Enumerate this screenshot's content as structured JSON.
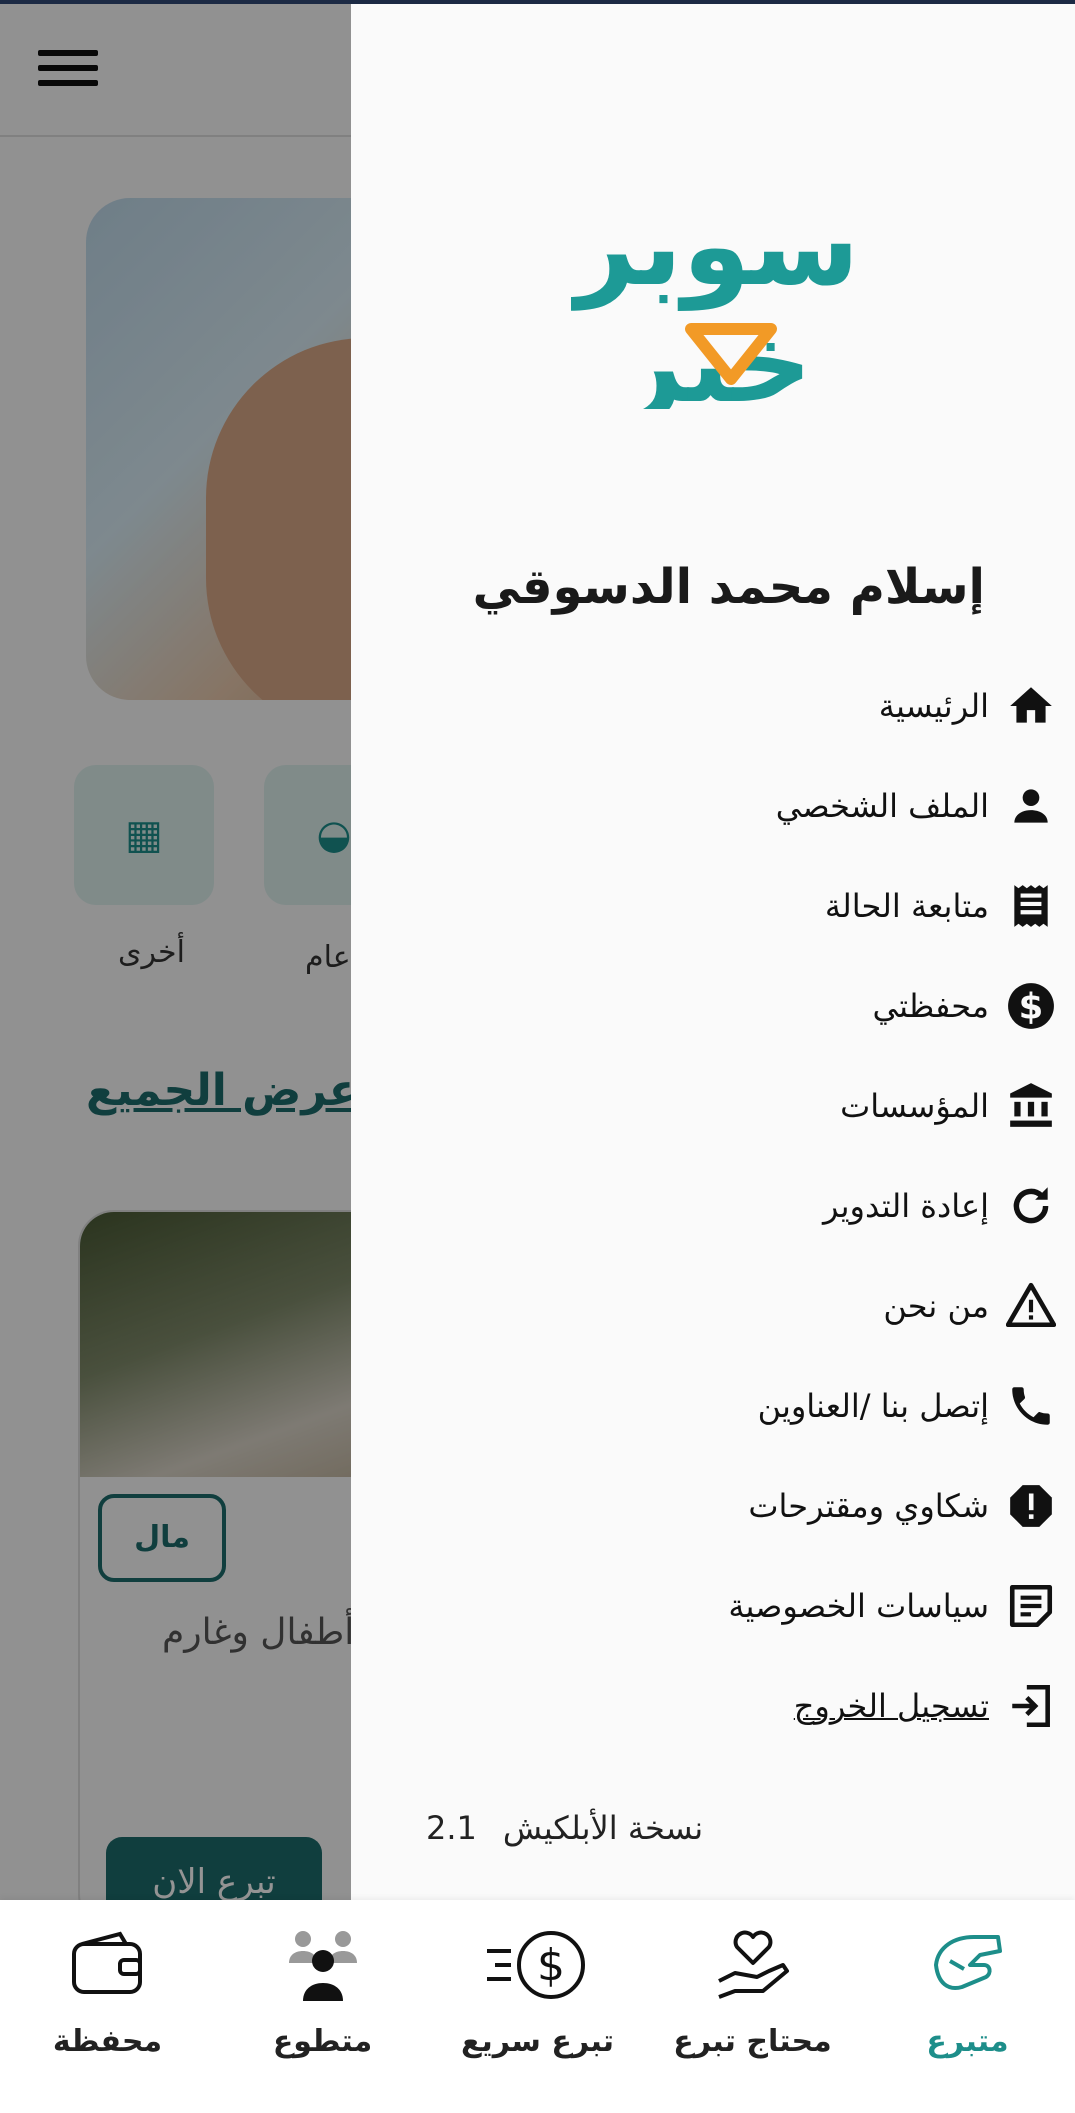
{
  "background": {
    "categories": [
      {
        "label": "أخرى",
        "icon": "grid-icon"
      },
      {
        "label": "عام",
        "icon": "food-icon"
      }
    ],
    "see_all": "إعرض الجميع",
    "card": {
      "tag": "مال",
      "text": "أطفال وغارم",
      "donate_button": "تبرع الان"
    }
  },
  "drawer": {
    "logo_top": "سوبر",
    "logo_bottom": "خير",
    "user_name": "إسلام محمد الدسوقي",
    "items": [
      {
        "label": "الرئيسية",
        "icon": "home-icon"
      },
      {
        "label": "الملف الشخصي",
        "icon": "person-icon"
      },
      {
        "label": "متابعة الحالة",
        "icon": "receipt-icon"
      },
      {
        "label": "محفظتي",
        "icon": "dollar-icon"
      },
      {
        "label": "المؤسسات",
        "icon": "bank-icon"
      },
      {
        "label": "إعادة التدوير",
        "icon": "refresh-icon"
      },
      {
        "label": "من نحن",
        "icon": "warning-icon"
      },
      {
        "label": "إتصل بنا /العناوين",
        "icon": "phone-icon"
      },
      {
        "label": "شكاوي ومقترحات",
        "icon": "alert-octagon-icon"
      },
      {
        "label": "سياسات الخصوصية",
        "icon": "note-icon"
      },
      {
        "label": "تسجيل الخروج",
        "icon": "logout-icon"
      }
    ],
    "version_label": "نسخة الأبلكيش",
    "version_number": "2.1"
  },
  "bottom_nav": [
    {
      "label": "محفظة",
      "icon": "wallet-icon",
      "active": false
    },
    {
      "label": "متطوع",
      "icon": "volunteers-icon",
      "active": false
    },
    {
      "label": "تبرع سريع",
      "icon": "fast-dollar-icon",
      "active": false
    },
    {
      "label": "محتاج تبرع",
      "icon": "heart-hand-icon",
      "active": false
    },
    {
      "label": "متبرع",
      "icon": "giving-hand-icon",
      "active": true
    }
  ],
  "colors": {
    "brand_teal": "#1d8e8a",
    "brand_orange": "#f29a26",
    "dark_teal": "#1d6b6b"
  }
}
